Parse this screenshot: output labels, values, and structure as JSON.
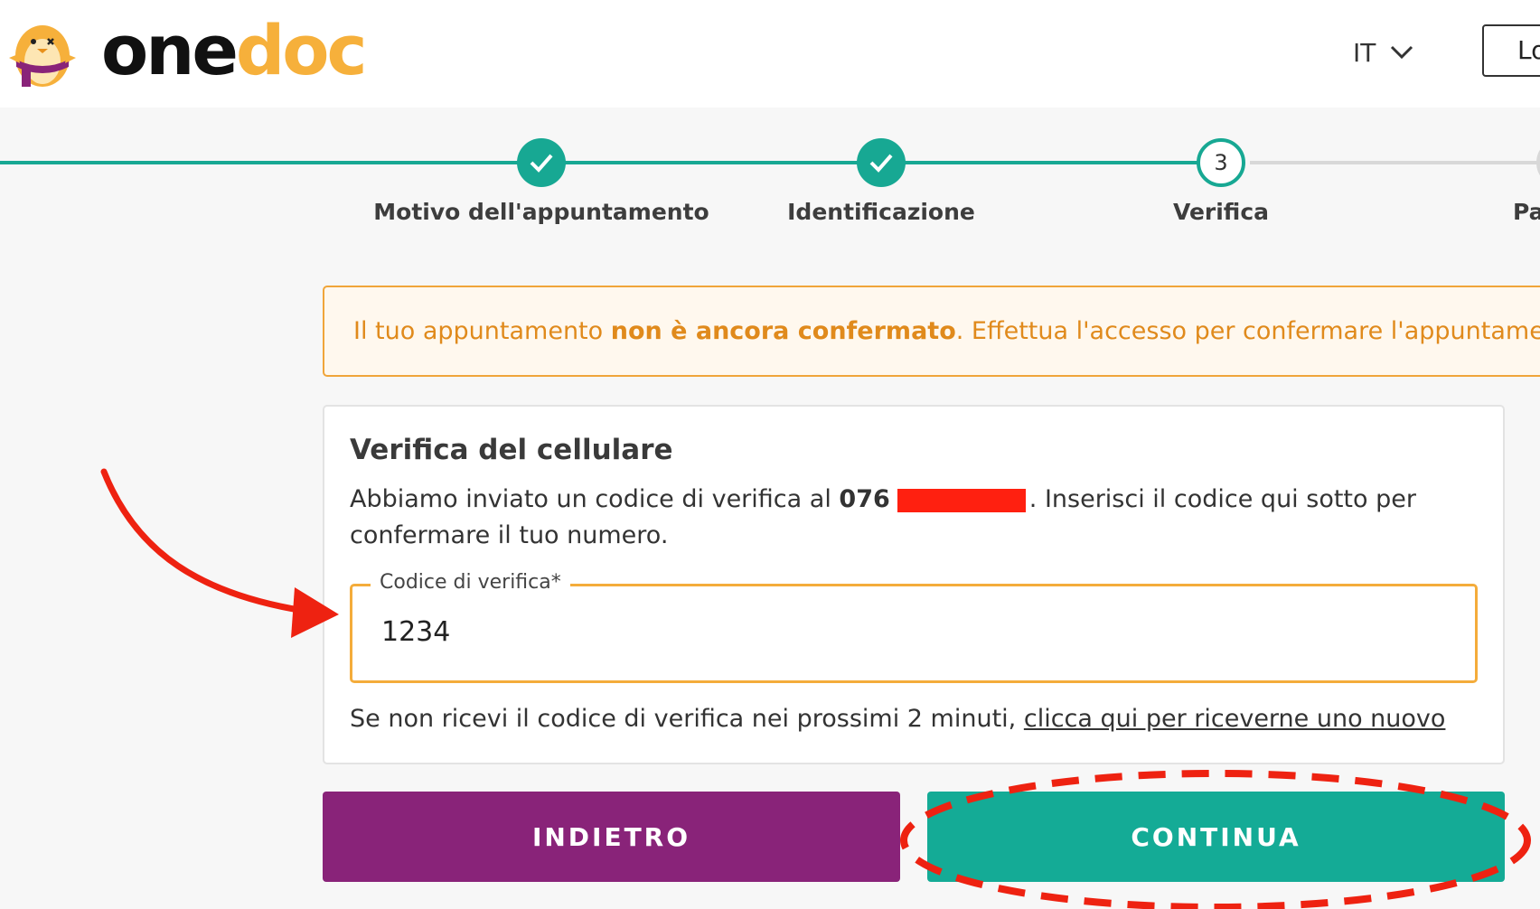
{
  "brand": {
    "name_part1": "one",
    "name_part2": "doc"
  },
  "header": {
    "language": "IT",
    "login_label": "Lo"
  },
  "steps": [
    {
      "label": "Motivo dell'appuntamento",
      "status": "done"
    },
    {
      "label": "Identificazione",
      "status": "done"
    },
    {
      "number": "3",
      "label": "Verifica",
      "status": "current"
    },
    {
      "label": "Pa",
      "status": "todo"
    }
  ],
  "banner": {
    "prefix": "Il tuo appuntamento ",
    "emphasis": "non è ancora confermato",
    "suffix": ". Effettua l'accesso per confermare l'appuntamento."
  },
  "verification": {
    "title": "Verifica del cellulare",
    "desc_prefix": "Abbiamo inviato un codice di verifica al ",
    "phone_prefix": "076",
    "desc_suffix": ". Inserisci il codice qui sotto per confermare il tuo numero.",
    "field_label": "Codice di verifica*",
    "field_value": "1234",
    "resend_text": "Se non ricevi il codice di verifica nei prossimi 2 minuti, ",
    "resend_link": "clicca qui per riceverne uno nuovo"
  },
  "buttons": {
    "back": "INDIETRO",
    "next": "CONTINUA"
  },
  "colors": {
    "accent_green": "#17a893",
    "accent_purple": "#892379",
    "warning_orange": "#e08a1c",
    "annotation_red": "#ee2211"
  },
  "icons": [
    "penguin-mascot-icon",
    "chevron-down-icon",
    "checkmark-icon"
  ]
}
